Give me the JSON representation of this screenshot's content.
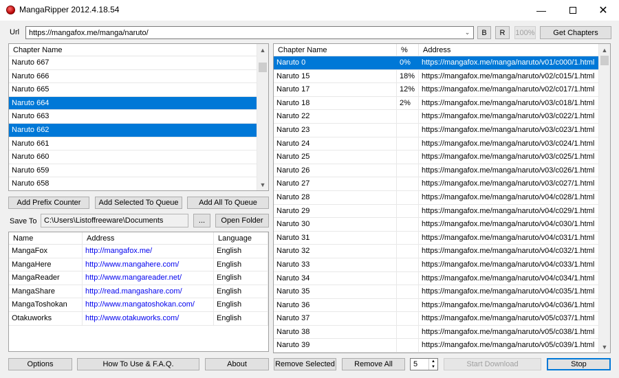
{
  "window": {
    "title": "MangaRipper 2012.4.18.54"
  },
  "url_bar": {
    "label": "Url",
    "value": "https://mangafox.me/manga/naruto/",
    "b_label": "B",
    "r_label": "R",
    "percent": "100%",
    "get_chapters": "Get Chapters"
  },
  "chapters": {
    "header": "Chapter Name",
    "items": [
      {
        "name": "Naruto 667",
        "selected": false
      },
      {
        "name": "Naruto 666",
        "selected": false
      },
      {
        "name": "Naruto 665",
        "selected": false
      },
      {
        "name": "Naruto 664",
        "selected": true
      },
      {
        "name": "Naruto 663",
        "selected": false
      },
      {
        "name": "Naruto 662",
        "selected": true
      },
      {
        "name": "Naruto 661",
        "selected": false
      },
      {
        "name": "Naruto 660",
        "selected": false
      },
      {
        "name": "Naruto 659",
        "selected": false
      },
      {
        "name": "Naruto 658",
        "selected": false
      }
    ]
  },
  "actions": {
    "add_prefix": "Add Prefix Counter",
    "add_selected": "Add Selected To Queue",
    "add_all": "Add All To Queue"
  },
  "save": {
    "label": "Save To",
    "path": "C:\\Users\\Listoffreeware\\Documents",
    "browse": "...",
    "open_folder": "Open Folder"
  },
  "sites": {
    "headers": [
      "Name",
      "Address",
      "Language"
    ],
    "items": [
      {
        "name": "MangaFox",
        "address": "http://mangafox.me/",
        "language": "English"
      },
      {
        "name": "MangaHere",
        "address": "http://www.mangahere.com/",
        "language": "English"
      },
      {
        "name": "MangaReader",
        "address": "http://www.mangareader.net/",
        "language": "English"
      },
      {
        "name": "MangaShare",
        "address": "http://read.mangashare.com/",
        "language": "English"
      },
      {
        "name": "MangaToshokan",
        "address": "http://www.mangatoshokan.com/",
        "language": "English"
      },
      {
        "name": "Otakuworks",
        "address": "http://www.otakuworks.com/",
        "language": "English"
      }
    ]
  },
  "queue": {
    "headers": [
      "Chapter Name",
      "%",
      "Address"
    ],
    "items": [
      {
        "name": "Naruto 0",
        "percent": "0%",
        "address": "https://mangafox.me/manga/naruto/v01/c000/1.html",
        "selected": true
      },
      {
        "name": "Naruto 15",
        "percent": "18%",
        "address": "https://mangafox.me/manga/naruto/v02/c015/1.html",
        "selected": false
      },
      {
        "name": "Naruto 17",
        "percent": "12%",
        "address": "https://mangafox.me/manga/naruto/v02/c017/1.html",
        "selected": false
      },
      {
        "name": "Naruto 18",
        "percent": "2%",
        "address": "https://mangafox.me/manga/naruto/v03/c018/1.html",
        "selected": false
      },
      {
        "name": "Naruto 22",
        "percent": "",
        "address": "https://mangafox.me/manga/naruto/v03/c022/1.html",
        "selected": false
      },
      {
        "name": "Naruto 23",
        "percent": "",
        "address": "https://mangafox.me/manga/naruto/v03/c023/1.html",
        "selected": false
      },
      {
        "name": "Naruto 24",
        "percent": "",
        "address": "https://mangafox.me/manga/naruto/v03/c024/1.html",
        "selected": false
      },
      {
        "name": "Naruto 25",
        "percent": "",
        "address": "https://mangafox.me/manga/naruto/v03/c025/1.html",
        "selected": false
      },
      {
        "name": "Naruto 26",
        "percent": "",
        "address": "https://mangafox.me/manga/naruto/v03/c026/1.html",
        "selected": false
      },
      {
        "name": "Naruto 27",
        "percent": "",
        "address": "https://mangafox.me/manga/naruto/v03/c027/1.html",
        "selected": false
      },
      {
        "name": "Naruto 28",
        "percent": "",
        "address": "https://mangafox.me/manga/naruto/v04/c028/1.html",
        "selected": false
      },
      {
        "name": "Naruto 29",
        "percent": "",
        "address": "https://mangafox.me/manga/naruto/v04/c029/1.html",
        "selected": false
      },
      {
        "name": "Naruto 30",
        "percent": "",
        "address": "https://mangafox.me/manga/naruto/v04/c030/1.html",
        "selected": false
      },
      {
        "name": "Naruto 31",
        "percent": "",
        "address": "https://mangafox.me/manga/naruto/v04/c031/1.html",
        "selected": false
      },
      {
        "name": "Naruto 32",
        "percent": "",
        "address": "https://mangafox.me/manga/naruto/v04/c032/1.html",
        "selected": false
      },
      {
        "name": "Naruto 33",
        "percent": "",
        "address": "https://mangafox.me/manga/naruto/v04/c033/1.html",
        "selected": false
      },
      {
        "name": "Naruto 34",
        "percent": "",
        "address": "https://mangafox.me/manga/naruto/v04/c034/1.html",
        "selected": false
      },
      {
        "name": "Naruto 35",
        "percent": "",
        "address": "https://mangafox.me/manga/naruto/v04/c035/1.html",
        "selected": false
      },
      {
        "name": "Naruto 36",
        "percent": "",
        "address": "https://mangafox.me/manga/naruto/v04/c036/1.html",
        "selected": false
      },
      {
        "name": "Naruto 37",
        "percent": "",
        "address": "https://mangafox.me/manga/naruto/v05/c037/1.html",
        "selected": false
      },
      {
        "name": "Naruto 38",
        "percent": "",
        "address": "https://mangafox.me/manga/naruto/v05/c038/1.html",
        "selected": false
      },
      {
        "name": "Naruto 39",
        "percent": "",
        "address": "https://mangafox.me/manga/naruto/v05/c039/1.html",
        "selected": false
      }
    ]
  },
  "bottom": {
    "options": "Options",
    "howto": "How To Use & F.A.Q.",
    "about": "About",
    "remove_selected": "Remove Selected",
    "remove_all": "Remove All",
    "thread_count": "5",
    "start_download": "Start Download",
    "stop": "Stop"
  },
  "colors": {
    "selection": "#0078d7",
    "link": "#0000ee",
    "button_bg": "#e1e1e1"
  }
}
